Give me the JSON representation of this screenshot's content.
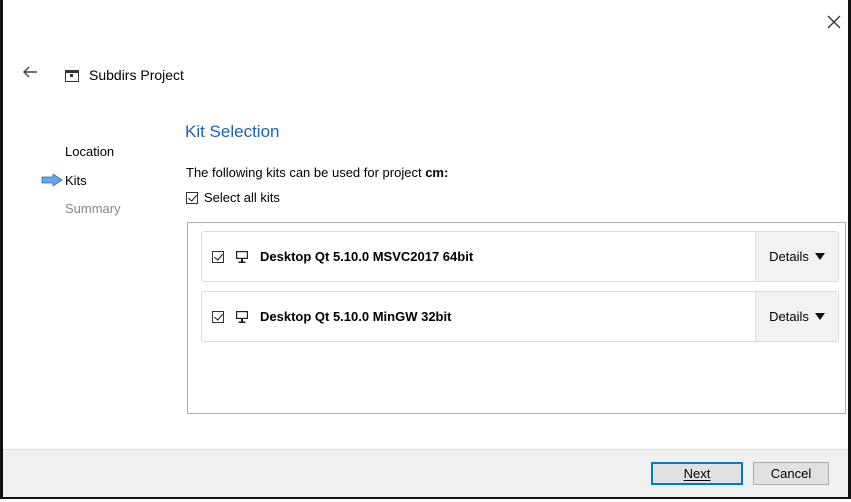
{
  "window": {
    "close_icon": "close-icon",
    "back_icon": "back-arrow-icon"
  },
  "header": {
    "title": "Subdirs Project",
    "icon": "project-icon"
  },
  "steps": {
    "items": [
      {
        "label": "Location",
        "state": "done"
      },
      {
        "label": "Kits",
        "state": "current"
      },
      {
        "label": "Summary",
        "state": "pending"
      }
    ],
    "current_indicator_color": "#4a90e2"
  },
  "main": {
    "section_title": "Kit Selection",
    "intro_prefix": "The following kits can be used for project ",
    "project_name": "cm",
    "intro_suffix": ":",
    "select_all_label": "Select all kits",
    "select_all_checked": true,
    "kits": [
      {
        "name": "Desktop Qt 5.10.0 MSVC2017 64bit",
        "checked": true,
        "details_label": "Details"
      },
      {
        "name": "Desktop Qt 5.10.0 MinGW 32bit",
        "checked": true,
        "details_label": "Details"
      }
    ]
  },
  "footer": {
    "next_label": "Next",
    "cancel_label": "Cancel"
  },
  "colors": {
    "accent": "#2060b8",
    "default_button_border": "#0078d7"
  }
}
